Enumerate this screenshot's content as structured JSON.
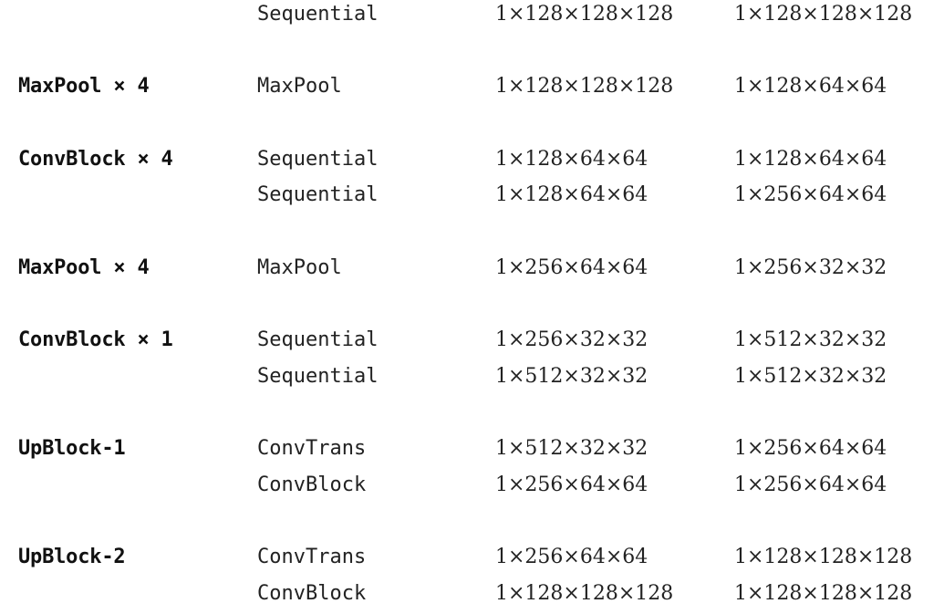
{
  "rows": [
    {
      "block": "",
      "layer": "Sequential",
      "input": "1×128×128×128",
      "output": "1×128×128×128"
    },
    {
      "block": "MaxPool × 4",
      "layer": "MaxPool",
      "input": "1×128×128×128",
      "output": "1×128×64×64"
    },
    {
      "block": "ConvBlock × 4",
      "layer": "Sequential",
      "input": "1×128×64×64",
      "output": "1×128×64×64"
    },
    {
      "block": "",
      "layer": "Sequential",
      "input": "1×128×64×64",
      "output": "1×256×64×64"
    },
    {
      "block": "MaxPool × 4",
      "layer": "MaxPool",
      "input": "1×256×64×64",
      "output": "1×256×32×32"
    },
    {
      "block": "ConvBlock × 1",
      "layer": "Sequential",
      "input": "1×256×32×32",
      "output": "1×512×32×32"
    },
    {
      "block": "",
      "layer": "Sequential",
      "input": "1×512×32×32",
      "output": "1×512×32×32"
    },
    {
      "block": "UpBlock-1",
      "layer": "ConvTrans",
      "input": "1×512×32×32",
      "output": "1×256×64×64"
    },
    {
      "block": "",
      "layer": "ConvBlock",
      "input": "1×256×64×64",
      "output": "1×256×64×64"
    },
    {
      "block": "UpBlock-2",
      "layer": "ConvTrans",
      "input": "1×256×64×64",
      "output": "1×128×128×128"
    },
    {
      "block": "",
      "layer": "ConvBlock",
      "input": "1×128×128×128",
      "output": "1×128×128×128"
    }
  ]
}
